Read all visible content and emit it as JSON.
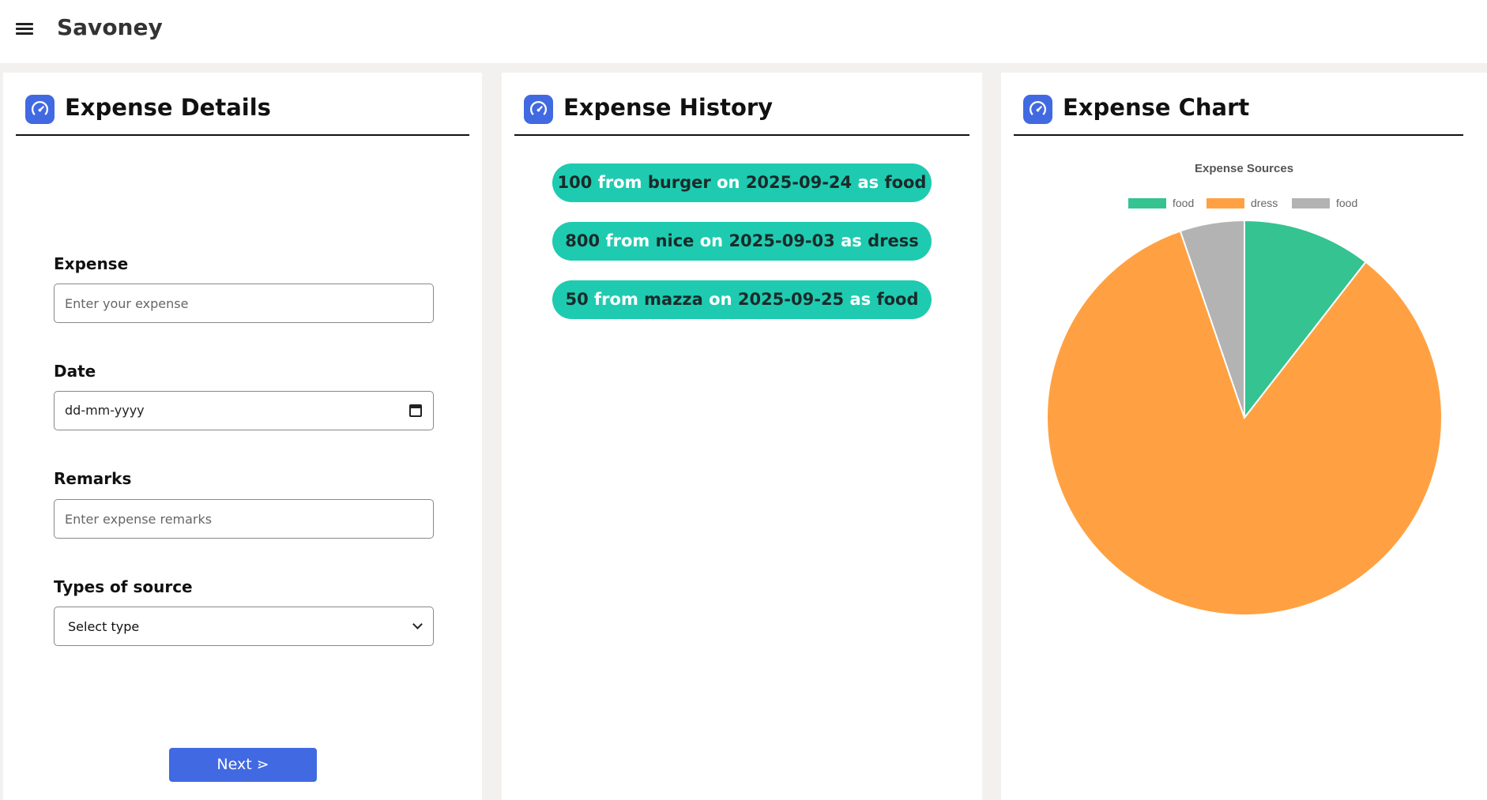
{
  "app": {
    "title": "Savoney",
    "menu_icon": "hamburger-menu-icon"
  },
  "expense_details": {
    "title": "Expense Details",
    "icon": "speedometer-icon",
    "expense": {
      "label": "Expense",
      "placeholder": "Enter your expense",
      "value": ""
    },
    "date": {
      "label": "Date",
      "placeholder": "dd-mm-yyyy",
      "icon": "calendar-icon"
    },
    "remarks": {
      "label": "Remarks",
      "placeholder": "Enter expense remarks",
      "value": ""
    },
    "source_type": {
      "label": "Types of source",
      "selected": "Select type"
    },
    "next_button": "Next ⋗"
  },
  "expense_history": {
    "title": "Expense History",
    "icon": "speedometer-icon",
    "from_word": "from",
    "on_word": "on",
    "as_word": "as",
    "items": [
      {
        "amount": "100",
        "source": "burger",
        "date": "2025-09-24",
        "type": "food"
      },
      {
        "amount": "800",
        "source": "nice",
        "date": "2025-09-03",
        "type": "dress"
      },
      {
        "amount": "50",
        "source": "mazza",
        "date": "2025-09-25",
        "type": "food"
      }
    ]
  },
  "expense_chart": {
    "title": "Expense Chart",
    "icon": "speedometer-icon"
  },
  "chart_data": {
    "type": "pie",
    "title": "Expense Sources",
    "categories": [
      "food",
      "dress",
      "food"
    ],
    "values": [
      100,
      800,
      50
    ],
    "colors": [
      "#34c391",
      "#ffa142",
      "#b3b3b3"
    ],
    "legend_position": "top"
  }
}
